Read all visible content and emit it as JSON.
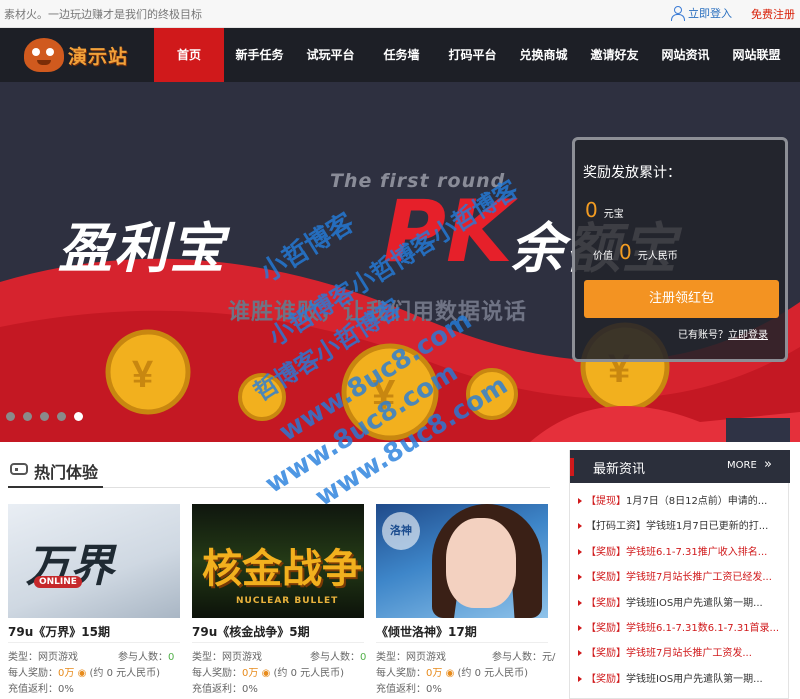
{
  "topbar": {
    "slogan": "素材火。一边玩边赚才是我们的终极目标",
    "login_label": "立即登入",
    "register_label": "免费注册"
  },
  "logo": {
    "text": "演示站",
    "icon": "mascot-icon"
  },
  "nav": {
    "items": [
      {
        "label": "首页",
        "active": true
      },
      {
        "label": "新手任务"
      },
      {
        "label": "试玩平台"
      },
      {
        "label": "任务墙"
      },
      {
        "label": "打码平台"
      },
      {
        "label": "兑换商城"
      },
      {
        "label": "邀请好友"
      },
      {
        "label": "网站资讯"
      },
      {
        "label": "网站联盟"
      }
    ]
  },
  "banner": {
    "round_text": "The first round",
    "headline_left": "盈利宝",
    "headline_pk": "PK",
    "headline_right": "余额宝",
    "subtitle": "谁胜谁败，让我们用数据说话",
    "slides_count": 5,
    "active_slide": 5
  },
  "reward": {
    "title": "奖励发放累计：",
    "yuanbao_value": "0",
    "yuanbao_unit": "元宝",
    "value_prefix": "价值",
    "rmb_value": "0",
    "rmb_unit": "元人民币",
    "cta_label": "注册领红包",
    "have_account": "已有账号？",
    "login_link": "立即登录"
  },
  "hot": {
    "title": "热门体验",
    "games": [
      {
        "name": "79u《万界》15期",
        "thumb_text": "万界",
        "thumb_badge": "ONLINE",
        "type": "类型：网页游戏",
        "participants_label": "参与人数：",
        "participants": "0",
        "reward_label": "每人奖励：",
        "reward_value": "0万",
        "reward_rmb": "(约 0 元人民币)",
        "rebate_label": "充值返利：",
        "rebate": "0%"
      },
      {
        "name": "79u《核金战争》5期",
        "thumb_text": "核金战争",
        "thumb_badge": "NUCLEAR BULLET",
        "type": "类型：网页游戏",
        "participants_label": "参与人数：",
        "participants": "0",
        "reward_label": "每人奖励：",
        "reward_value": "0万",
        "reward_rmb": "(约 0 元人民币)",
        "rebate_label": "充值返利：",
        "rebate": "0%"
      },
      {
        "name": "《倾世洛神》17期",
        "thumb_text": "洛神",
        "type": "类型：网页游戏",
        "participants_label": "参与人数：",
        "participants": "元/",
        "reward_label": "每人奖励：",
        "reward_value": "0万",
        "reward_rmb": "(约 0 元人民币)",
        "rebate_label": "充值返利：",
        "rebate": "0%"
      }
    ]
  },
  "news": {
    "title": "最新资讯",
    "more_label": "MORE",
    "arrow": "»",
    "items": [
      {
        "tag": "【提现】",
        "text": "1月7日（8日12点前）申请的..."
      },
      {
        "tag": "【打码工资】",
        "text": "学钱班1月7日已更新的打..."
      },
      {
        "tag": "【奖励】",
        "text": "学钱班6.1-7.31推广收入排名..."
      },
      {
        "tag": "【奖励】",
        "text": "学钱班7月站长推广工资已经发..."
      },
      {
        "tag": "【奖励】",
        "text": "学钱班IOS用户先遣队第一期..."
      },
      {
        "tag": "【奖励】",
        "text": "学钱班6.1-7.31数6.1-7.31首录..."
      },
      {
        "tag": "【奖励】",
        "text": "学钱班7月站长推广工资发..."
      },
      {
        "tag": "【奖励】",
        "text": "学钱班IOS用户先遣队第一期..."
      }
    ]
  },
  "watermarks": [
    "小哲博客",
    "小哲博客小哲博客小哲博客",
    "哲博客小哲博客",
    "www.8uc8.com",
    "www.8uc8.com",
    "www.8uc8.com"
  ],
  "colors": {
    "brand_red": "#d0191b",
    "accent_orange": "#f39322",
    "nav_bg": "#1d1f26",
    "link_blue": "#2a6fbf"
  }
}
